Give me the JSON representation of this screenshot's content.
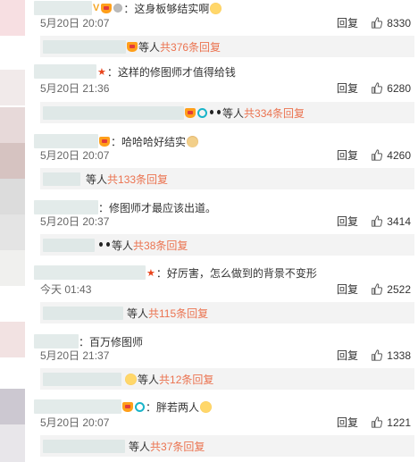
{
  "colors": {
    "link": "#eb7350",
    "text": "#333333",
    "time": "#666666",
    "sub_bg": "#f3f3f3"
  },
  "comments": [
    {
      "text": "：这身板够结实啊",
      "time": "5月20日 20:07",
      "reply": "回复",
      "likes": "8330",
      "sub": {
        "prefix": "等人",
        "more": "共376条回复"
      }
    },
    {
      "text": "：这样的修图师才值得给钱",
      "time": "5月20日 21:36",
      "reply": "回复",
      "likes": "6280",
      "sub": {
        "prefix": "等人",
        "more": "共334条回复"
      }
    },
    {
      "text": "：哈哈哈好结实",
      "time": "5月20日 20:07",
      "reply": "回复",
      "likes": "4260",
      "sub": {
        "prefix": "等人",
        "more": "共133条回复"
      }
    },
    {
      "text": "：修图师才最应该出道。",
      "time": "5月20日 20:37",
      "reply": "回复",
      "likes": "3414",
      "sub": {
        "prefix": "等人",
        "more": "共38条回复"
      }
    },
    {
      "text": "：好厉害，怎么做到的背景不变形",
      "time": "今天 01:43",
      "reply": "回复",
      "likes": "2522",
      "sub": {
        "prefix": "等人",
        "more": "共115条回复"
      }
    },
    {
      "text": "：百万修图师",
      "time": "5月20日 21:37",
      "reply": "回复",
      "likes": "1338",
      "sub": {
        "prefix": "等人",
        "more": "共12条回复"
      }
    },
    {
      "text": "：胖若两人",
      "time": "5月20日 20:07",
      "reply": "回复",
      "likes": "1221",
      "sub": {
        "prefix": "等人",
        "more": "共37条回复"
      }
    }
  ]
}
